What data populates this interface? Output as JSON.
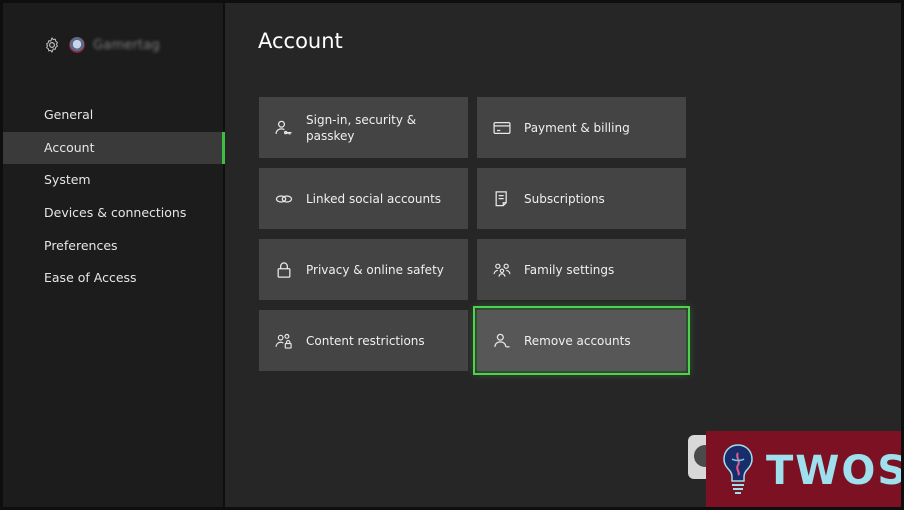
{
  "header": {
    "title": "Account"
  },
  "profile": {
    "gamertag": "Gamertag",
    "icons": [
      "gear-icon",
      "avatar"
    ]
  },
  "sidebar": {
    "items": [
      {
        "label": "General",
        "selected": false
      },
      {
        "label": "Account",
        "selected": true
      },
      {
        "label": "System",
        "selected": false
      },
      {
        "label": "Devices & connections",
        "selected": false
      },
      {
        "label": "Preferences",
        "selected": false
      },
      {
        "label": "Ease of Access",
        "selected": false
      }
    ]
  },
  "tiles": [
    {
      "label": "Sign-in, security & passkey",
      "icon": "person-key-icon",
      "focused": false
    },
    {
      "label": "Payment & billing",
      "icon": "credit-card-icon",
      "focused": false
    },
    {
      "label": "Linked social accounts",
      "icon": "link-icon",
      "focused": false
    },
    {
      "label": "Subscriptions",
      "icon": "receipt-icon",
      "focused": false
    },
    {
      "label": "Privacy & online safety",
      "icon": "lock-icon",
      "focused": false
    },
    {
      "label": "Family settings",
      "icon": "family-icon",
      "focused": false
    },
    {
      "label": "Content restrictions",
      "icon": "people-lock-icon",
      "focused": false
    },
    {
      "label": "Remove accounts",
      "icon": "person-remove-icon",
      "focused": true
    }
  ],
  "watermark": {
    "text": "TWOS"
  },
  "colors": {
    "background": "#262626",
    "sidebar": "#1c1c1c",
    "tile": "#444444",
    "tile_focused": "#575757",
    "accent_green": "#4fd24f",
    "watermark_bg": "#7b1122",
    "watermark_text": "#9ee0ee"
  }
}
